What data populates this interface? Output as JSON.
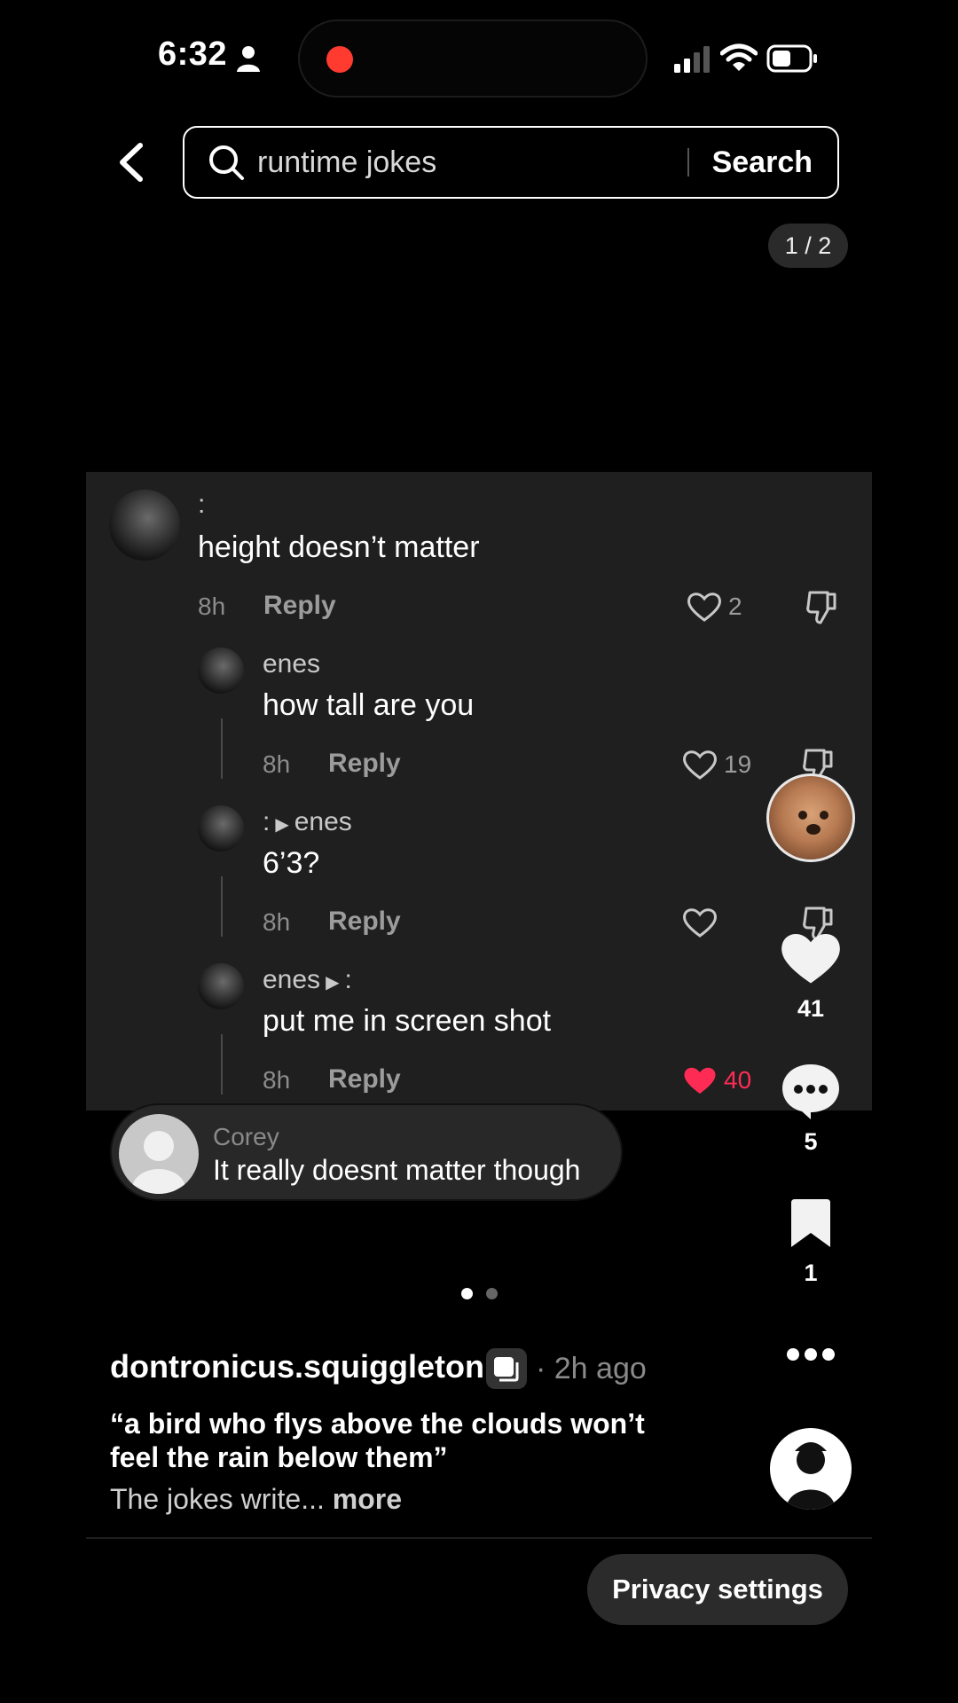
{
  "status": {
    "time": "6:32"
  },
  "search": {
    "query": "runtime jokes",
    "button": "Search",
    "counter": "1 / 2"
  },
  "comments": [
    {
      "name": ":",
      "text": "height doesn’t matter",
      "time": "8h",
      "reply": "Reply",
      "likes": "2"
    },
    {
      "name": "enes",
      "text": "how tall are you",
      "time": "8h",
      "reply": "Reply",
      "likes": "19"
    },
    {
      "from": ":",
      "to": "enes",
      "text": "6’3?",
      "time": "8h",
      "reply": "Reply",
      "likes": ""
    },
    {
      "from": "enes",
      "to": ":",
      "text": "put me in screen shot",
      "time": "8h",
      "reply": "Reply",
      "likes": "40"
    }
  ],
  "toast": {
    "name": "Corey",
    "text": "It really doesnt matter though"
  },
  "rail": {
    "likes": "41",
    "comments": "5",
    "saves": "1"
  },
  "pagination": {
    "total": 2,
    "active": 1
  },
  "post": {
    "author": "dontronicus.squiggleton",
    "time": "· 2h ago",
    "title": "“a bird who flys above the clouds won’t feel the rain below them”",
    "body": "The jokes write...",
    "more": "more"
  },
  "privacy": "Privacy settings",
  "colors": {
    "liked": "#fe2c55",
    "background": "#000000",
    "card": "#1f1f1f",
    "record": "#ff3b30"
  }
}
